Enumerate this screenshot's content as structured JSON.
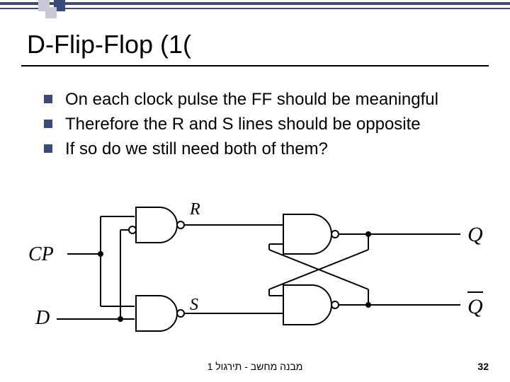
{
  "title": "D-Flip-Flop (1(",
  "bullets": [
    "On each clock pulse the FF should be meaningful",
    "Therefore the R and S lines should be opposite",
    "If so do we still need both of them?"
  ],
  "diagram": {
    "labels": {
      "CP": "CP",
      "D": "D",
      "R": "R",
      "S": "S",
      "Q": "Q",
      "Qbar": "Q̄"
    }
  },
  "footer": "מבנה מחשב - תירגול 1",
  "page_number": "32",
  "colors": {
    "accent": "#3a4a7a",
    "light_box": "#c8c8d8"
  }
}
